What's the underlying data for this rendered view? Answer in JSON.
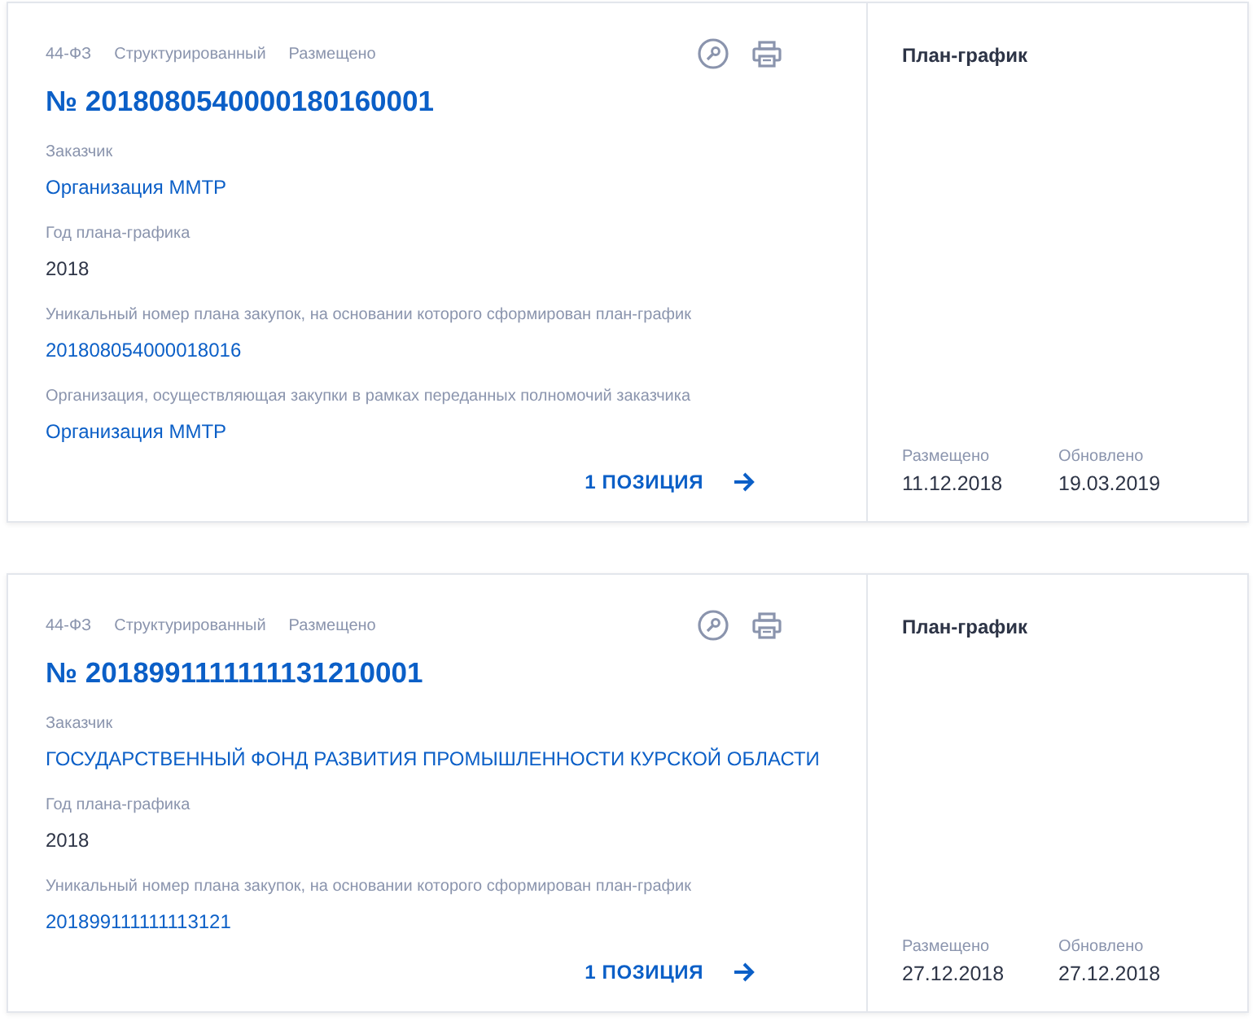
{
  "cards": [
    {
      "tags": [
        "44-ФЗ",
        "Структурированный",
        "Размещено"
      ],
      "number": "№ 2018080540000180160001",
      "fields": [
        {
          "label": "Заказчик",
          "value": "Организация ММТР",
          "kind": "link"
        },
        {
          "label": "Год плана-графика",
          "value": "2018",
          "kind": "text"
        },
        {
          "label": "Уникальный номер плана закупок, на основании которого сформирован план-график",
          "value": "201808054000018016",
          "kind": "link"
        },
        {
          "label": "Организация, осуществляющая закупки в рамках переданных полномочий заказчика",
          "value": "Организация ММТР",
          "kind": "link"
        }
      ],
      "positions": "1 ПОЗИЦИЯ",
      "type": "План-график",
      "dates": [
        {
          "label": "Размещено",
          "value": "11.12.2018"
        },
        {
          "label": "Обновлено",
          "value": "19.03.2019"
        }
      ]
    },
    {
      "tags": [
        "44-ФЗ",
        "Структурированный",
        "Размещено"
      ],
      "number": "№ 2018991111111131210001",
      "fields": [
        {
          "label": "Заказчик",
          "value": "ГОСУДАРСТВЕННЫЙ ФОНД РАЗВИТИЯ ПРОМЫШЛЕННОСТИ КУРСКОЙ ОБЛАСТИ",
          "kind": "link"
        },
        {
          "label": "Год плана-графика",
          "value": "2018",
          "kind": "text"
        },
        {
          "label": "Уникальный номер плана закупок, на основании которого сформирован план-график",
          "value": "201899111111113121",
          "kind": "link"
        }
      ],
      "positions": "1 ПОЗИЦИЯ",
      "type": "План-график",
      "dates": [
        {
          "label": "Размещено",
          "value": "27.12.2018"
        },
        {
          "label": "Обновлено",
          "value": "27.12.2018"
        }
      ]
    }
  ]
}
